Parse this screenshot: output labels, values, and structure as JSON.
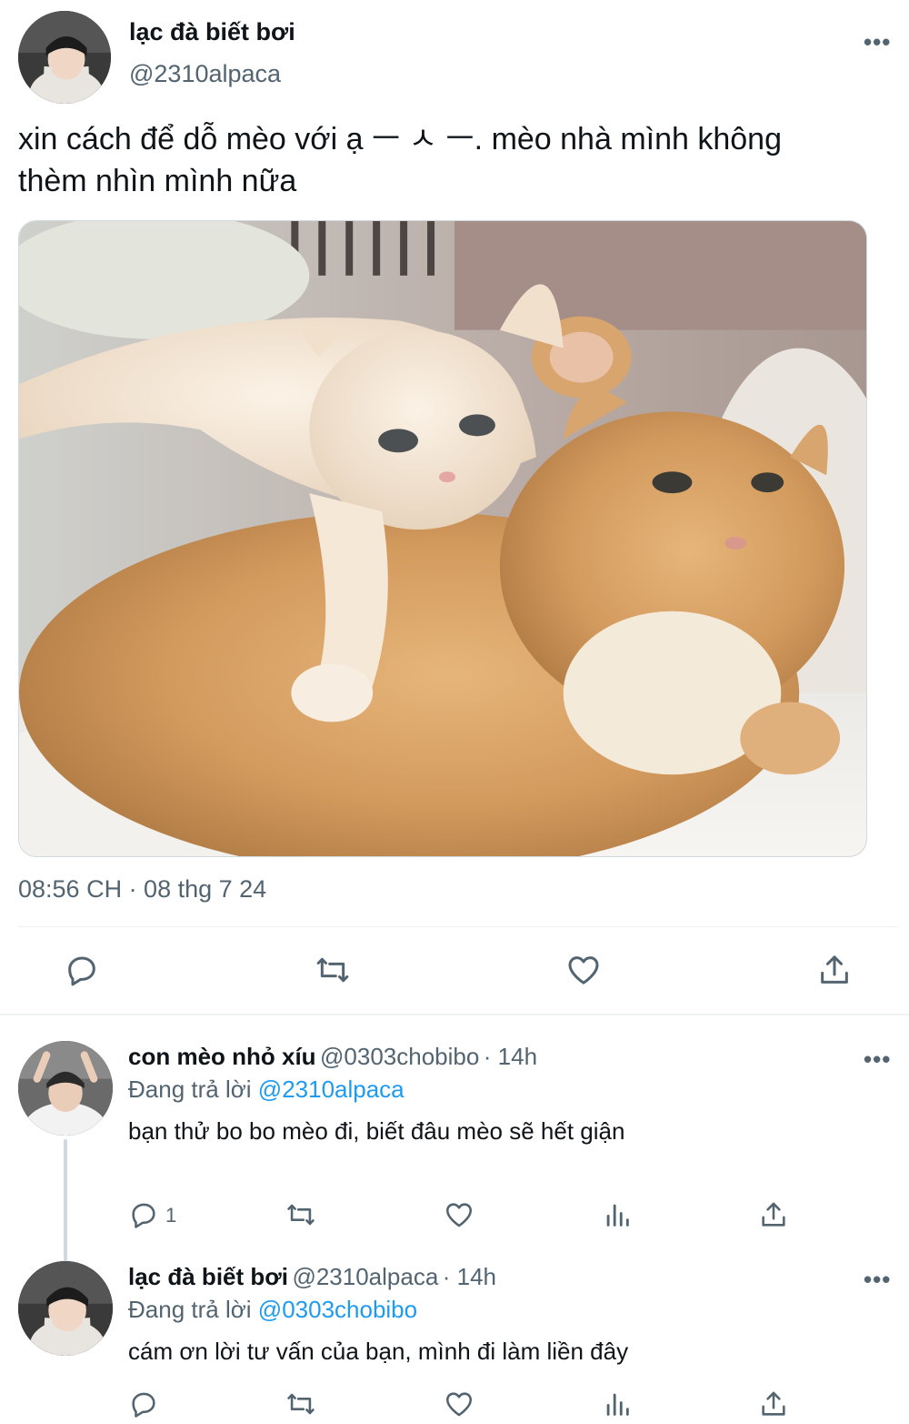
{
  "main_tweet": {
    "author_name": "lạc đà biết bơi",
    "author_handle": "@2310alpaca",
    "text_line1": "xin cách để dỗ mèo với ạ ㅡ ㅅ ㅡ. mèo nhà mình không",
    "text_line2": "thèm nhìn mình nữa",
    "timestamp": "08:56 CH · 08 thg 7 24",
    "more_label": "•••",
    "image_description": "two cats photo"
  },
  "replies": [
    {
      "author_name": "con mèo nhỏ xíu",
      "author_handle": "@0303chobibo",
      "time": "· 14h",
      "replying_prefix": "Đang trả lời",
      "replying_to": "@2310alpaca",
      "text": "bạn thử bo bo mèo đi, biết đâu mèo sẽ hết giận",
      "reply_count": "1",
      "more_label": "•••"
    },
    {
      "author_name": "lạc đà biết bơi",
      "author_handle": "@2310alpaca",
      "time": "· 14h",
      "replying_prefix": "Đang trả lời",
      "replying_to": "@0303chobibo",
      "text": "cám ơn lời tư vấn của bạn, mình đi làm liền đây",
      "more_label": "•••"
    }
  ],
  "colors": {
    "accent": "#1d9bf0",
    "secondary_text": "#536471",
    "primary_text": "#0f1419",
    "divider": "#eff3f4"
  },
  "icons": [
    "reply-icon",
    "retweet-icon",
    "like-icon",
    "share-icon",
    "views-icon",
    "more-icon"
  ]
}
